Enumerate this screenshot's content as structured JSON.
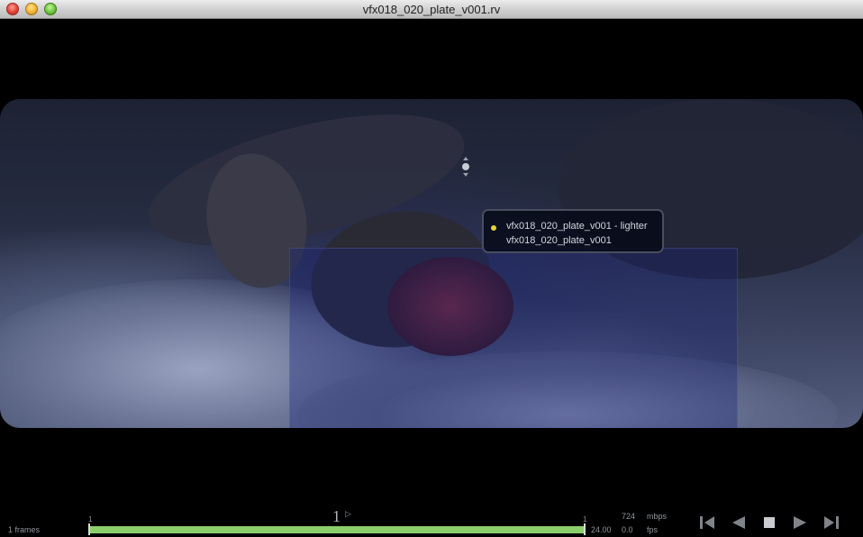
{
  "window": {
    "title": "vfx018_020_plate_v001.rv",
    "close_glyph": "×",
    "min_glyph": "−",
    "max_glyph": "+"
  },
  "viewer": {
    "info_overlay": {
      "line1": "vfx018_020_plate_v001 - lighter",
      "line2": "vfx018_020_plate_v001",
      "bullet_color": "#e8d23a"
    },
    "selection_tint": "#19237a"
  },
  "timeline": {
    "frames_count": "1 frames",
    "start_frame": "1",
    "end_frame": "1",
    "current_frame": "1",
    "current_marker": "▷",
    "progress": 1.0,
    "progress_color": "#8bcf6d",
    "fps_target": "24.00",
    "fps_actual": "0.0",
    "fps_label": "fps",
    "mbps_value": "724",
    "mbps_label": "mbps"
  },
  "controls": [
    {
      "name": "step-back-button",
      "icon": "step-back-icon"
    },
    {
      "name": "play-backward-button",
      "icon": "play-backward-icon"
    },
    {
      "name": "stop-button",
      "icon": "stop-icon"
    },
    {
      "name": "play-forward-button",
      "icon": "play-forward-icon"
    },
    {
      "name": "step-forward-button",
      "icon": "step-forward-icon"
    }
  ]
}
